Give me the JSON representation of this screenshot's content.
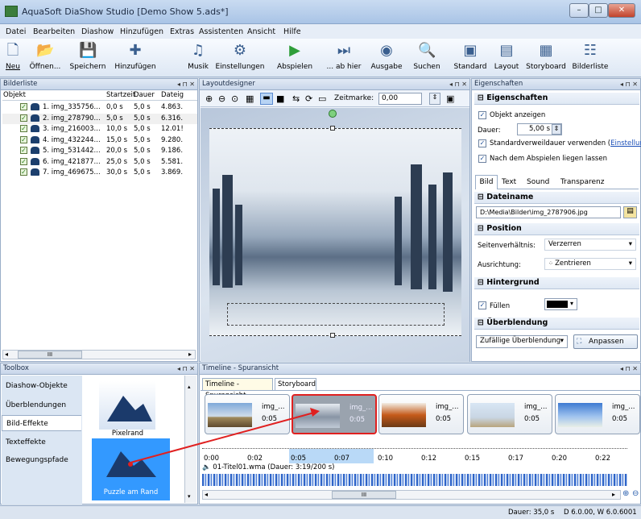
{
  "window": {
    "title": "AquaSoft DiaShow Studio [Demo Show 5.ads*]",
    "min": "–",
    "max": "□",
    "close": "✕"
  },
  "menu": [
    "Datei",
    "Bearbeiten",
    "Diashow",
    "Hinzufügen",
    "Extras",
    "Assistenten",
    "Ansicht",
    "Hilfe"
  ],
  "toolbar": {
    "items": [
      {
        "label": "Neu",
        "icon": "new-icon"
      },
      {
        "label": "Öffnen...",
        "icon": "open-icon"
      },
      {
        "label": "Speichern",
        "icon": "save-icon"
      },
      {
        "label": "Hinzufügen",
        "icon": "add-icon"
      },
      {
        "label": "Musik",
        "icon": "music-icon"
      },
      {
        "label": "Einstellungen",
        "icon": "settings-icon"
      },
      {
        "label": "Abspielen",
        "icon": "play-icon"
      },
      {
        "label": "... ab hier",
        "icon": "play-from-here-icon"
      },
      {
        "label": "Ausgabe",
        "icon": "output-icon"
      },
      {
        "label": "Suchen",
        "icon": "search-icon"
      },
      {
        "label": "Standard",
        "icon": "standard-view-icon"
      },
      {
        "label": "Layout",
        "icon": "layout-view-icon"
      },
      {
        "label": "Storyboard",
        "icon": "storyboard-view-icon"
      },
      {
        "label": "Bilderliste",
        "icon": "imagelist-view-icon"
      }
    ]
  },
  "bilderliste": {
    "title": "Bilderliste",
    "controls": "◂ ⊓ ✕",
    "columns": [
      "Objekt",
      "Startzeit",
      "Dauer",
      "Dateig"
    ],
    "rows": [
      {
        "name": "1. img_335756...",
        "start": "0,0 s",
        "dur": "5,0 s",
        "size": "4.863."
      },
      {
        "name": "2. img_278790...",
        "start": "5,0 s",
        "dur": "5,0 s",
        "size": "6.316."
      },
      {
        "name": "3. img_216003...",
        "start": "10,0 s",
        "dur": "5,0 s",
        "size": "12.01!"
      },
      {
        "name": "4. img_432244...",
        "start": "15,0 s",
        "dur": "5,0 s",
        "size": "9.280."
      },
      {
        "name": "5. img_531442...",
        "start": "20,0 s",
        "dur": "5,0 s",
        "size": "9.186."
      },
      {
        "name": "6. img_421877...",
        "start": "25,0 s",
        "dur": "5,0 s",
        "size": "5.581."
      },
      {
        "name": "7. img_469675...",
        "start": "30,0 s",
        "dur": "5,0 s",
        "size": "3.869."
      }
    ],
    "scroll": "III"
  },
  "layout": {
    "title": "Layoutdesigner",
    "controls": "◂ ⊓ ✕",
    "zeitmarke_label": "Zeitmarke:",
    "zeitmarke_value": "0,00"
  },
  "props": {
    "title": "Eigenschaften",
    "controls": "◂ ⊓ ✕",
    "sect_eigenschaften": "Eigenschaften",
    "objekt_anzeigen": "Objekt anzeigen",
    "dauer_label": "Dauer:",
    "dauer_value": "5,00 s",
    "standard_text": "Standardverweildauer verwenden (",
    "standard_link": "Einstellungen",
    "standard_close": ")",
    "nach_abspielen": "Nach dem Abspielen liegen lassen",
    "tabs": [
      "Bild",
      "Text",
      "Sound",
      "Transparenz"
    ],
    "sect_dateiname": "Dateiname",
    "dateiname": "D:\\Media\\Bilder\\img_2787906.jpg",
    "sect_position": "Position",
    "seiten_label": "Seitenverhältnis:",
    "seiten_value": "Verzerren",
    "ausrichtung_label": "Ausrichtung:",
    "ausrichtung_value": "Zentrieren",
    "sect_hintergrund": "Hintergrund",
    "fuellen": "Füllen",
    "sect_ueberblendung": "Überblendung",
    "ueberblendung_value": "Zufällige Überblendung",
    "anpassen": "Anpassen"
  },
  "toolbox": {
    "title": "Toolbox",
    "controls": "◂ ⊓ ✕",
    "items": [
      "Diashow-Objekte",
      "Überblendungen",
      "Bild-Effekte",
      "Texteffekte",
      "Bewegungspfade"
    ],
    "effect1": "Pixelrand",
    "effect2": "Puzzle am Rand"
  },
  "timeline": {
    "title": "Timeline - Spuransicht",
    "controls": "◂ ⊓ ✕",
    "tabs": [
      "Timeline - Spuransicht",
      "Storyboard"
    ],
    "clips": [
      {
        "name": "img_...",
        "dur": "0:05"
      },
      {
        "name": "img_...",
        "dur": "0:05"
      },
      {
        "name": "img_...",
        "dur": "0:05"
      },
      {
        "name": "img_...",
        "dur": "0:05"
      },
      {
        "name": "img_...",
        "dur": "0:05"
      }
    ],
    "ruler": [
      "0:00",
      "0:02",
      "0:05",
      "0:07",
      "0:10",
      "0:12",
      "0:15",
      "0:17",
      "0:20",
      "0:22"
    ],
    "audio": "01-Titel01.wma (Dauer: 3:19/200 s)",
    "scroll": "III"
  },
  "status": {
    "dauer": "Dauer: 35,0 s",
    "info": "D 6.0.00, W 6.0.6001"
  },
  "colors": {
    "accent": "#3399ff",
    "highlight": "#e02020"
  }
}
